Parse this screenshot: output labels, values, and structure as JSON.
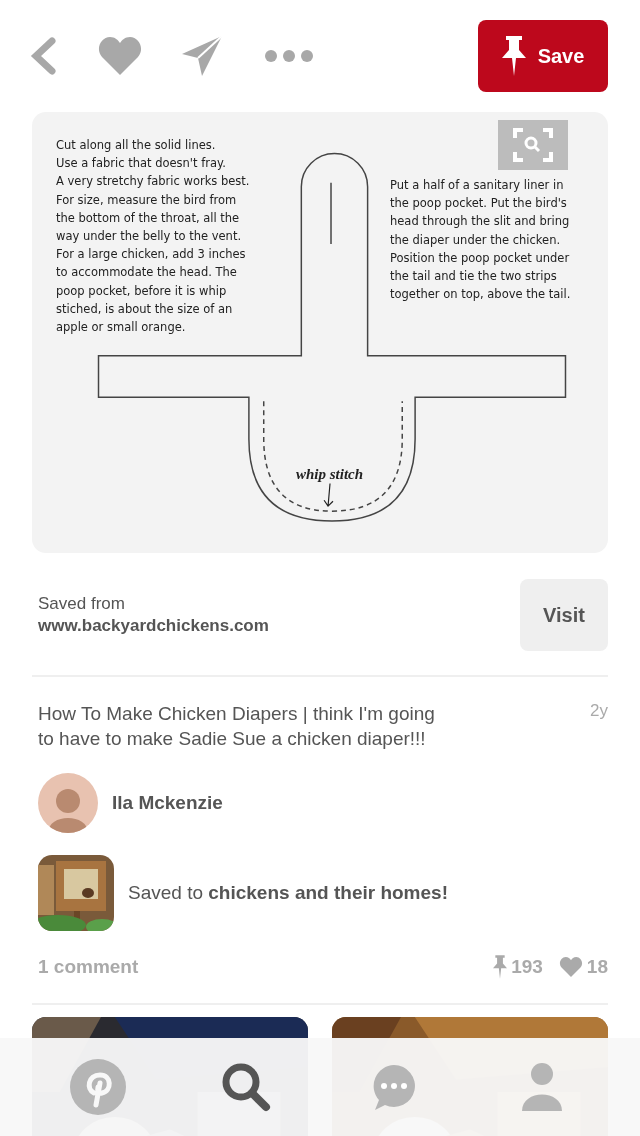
{
  "header": {
    "save_button": "Save"
  },
  "pin_image": {
    "kind": "document",
    "left_lines": [
      "Cut along all the solid lines.",
      "Use a fabric that doesn't fray.",
      "A very stretchy fabric works best.",
      "For size, measure the bird from",
      "the bottom of the throat, all the",
      "way under the belly to the vent.",
      "For a large chicken, add 3 inches",
      "to accommodate the head. The",
      "poop pocket, before it is whip",
      "stiched, is about the size of an",
      "apple or small orange."
    ],
    "right_lines": [
      "Put a half of a sanitary liner in",
      "the poop pocket. Put the bird's",
      "head through the slit and bring",
      "the diaper under the chicken.",
      "Position the poop pocket under",
      "the tail and tie the two strips",
      "together on top, above the tail."
    ],
    "stitch_label": "whip stitch"
  },
  "source": {
    "label": "Saved from",
    "url": "www.backyardchickens.com",
    "button": "Visit"
  },
  "description": "How To Make Chicken Diapers | think I'm going to have to make Sadie Sue a chicken diaper!!!",
  "age": "2y",
  "author": {
    "name": "Ila Mckenzie"
  },
  "board": {
    "text": "Saved to **chickens and their homes!**"
  },
  "stats": {
    "comments": "1 comment",
    "saves": "193",
    "likes": "18"
  },
  "tab_bar": [
    {
      "kind": "home",
      "selected": false
    },
    {
      "kind": "search",
      "selected": true
    },
    {
      "kind": "messages",
      "selected": false
    },
    {
      "kind": "profile",
      "selected": false
    }
  ]
}
